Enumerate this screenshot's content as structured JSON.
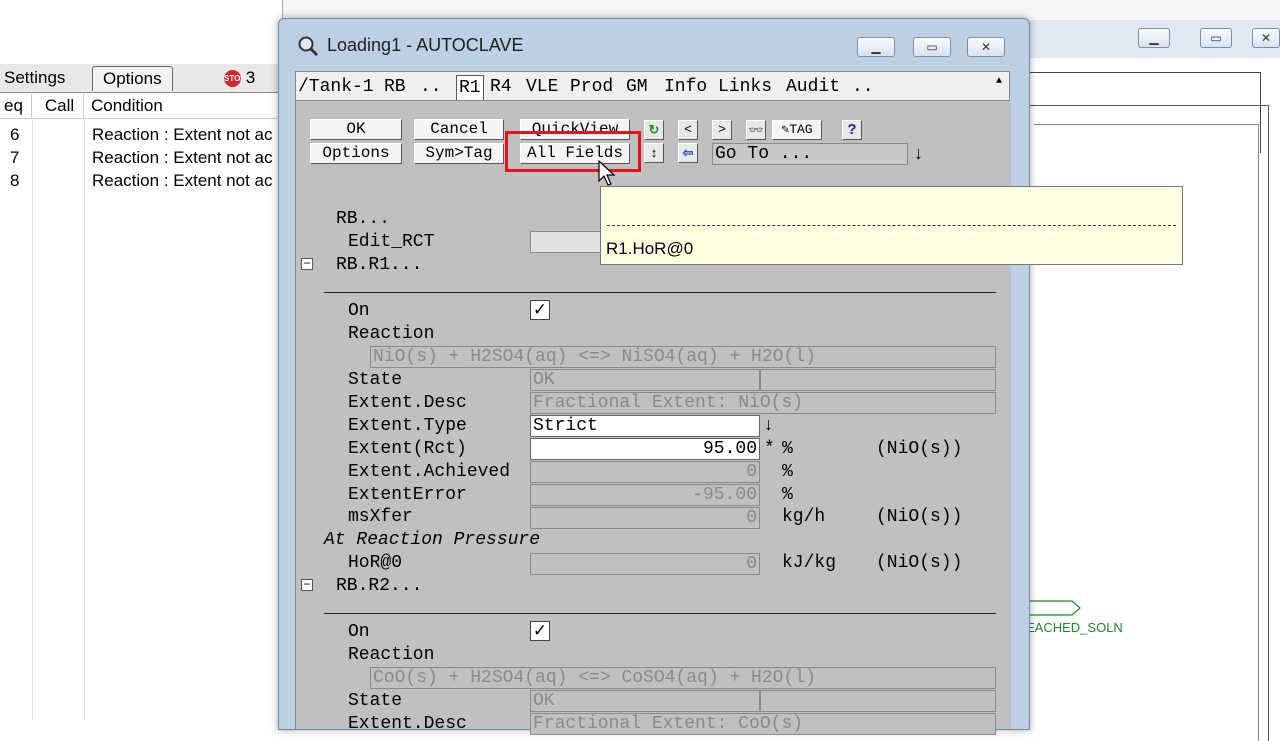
{
  "left_panel": {
    "tabs": [
      "Settings",
      "Options"
    ],
    "stop_badge": "STOP",
    "stop_count": "3",
    "columns": [
      "eq",
      "Call",
      "Condition"
    ],
    "rows": [
      {
        "seq": "6",
        "condition": "Reaction : Extent not ac"
      },
      {
        "seq": "7",
        "condition": "Reaction : Extent not ac"
      },
      {
        "seq": "8",
        "condition": "Reaction : Extent not ac"
      }
    ]
  },
  "right_panel": {
    "flow_label": "EACHED_SOLN",
    "flow_color": "#1a8a2a"
  },
  "dialog": {
    "title": "Loading1 - AUTOCLAVE",
    "tabs": [
      "/Tank-1",
      "RB",
      "..",
      "R1",
      "R4",
      "VLE",
      "Prod",
      "GM",
      "Info",
      "Links",
      "Audit",
      ".."
    ],
    "buttons": {
      "ok": "OK",
      "cancel": "Cancel",
      "quickview": "QuickView",
      "options": "Options",
      "symtag": "Sym>Tag",
      "allfields": "All Fields",
      "prev": "<",
      "next": ">",
      "tag": "TAG",
      "help": "?"
    },
    "goto": "Go To ...",
    "tooltip": "R1.HoR@0",
    "highlight_color": "#e3131b",
    "rb": {
      "label": "RB...",
      "edit_rct": "Edit_RCT"
    },
    "r1": {
      "header": "RB.R1...",
      "on": "On",
      "reaction_label": "Reaction",
      "reaction": "NiO(s) + H2SO4(aq) <=> NiSO4(aq) + H2O(l)",
      "state_label": "State",
      "state": "OK",
      "extent_desc_label": "Extent.Desc",
      "extent_desc": "Fractional Extent: NiO(s)",
      "extent_type_label": "Extent.Type",
      "extent_type": "Strict",
      "extent_rct_label": "Extent(Rct)",
      "extent_rct": "95.00",
      "extent_rct_unit": "%",
      "extent_rct_species": "(NiO(s))",
      "extent_achieved_label": "Extent.Achieved",
      "extent_achieved": "0",
      "extent_achieved_unit": "%",
      "extent_error_label": "ExtentError",
      "extent_error": "-95.00",
      "extent_error_unit": "%",
      "msxfer_label": "msXfer",
      "msxfer": "0",
      "msxfer_unit": "kg/h",
      "msxfer_species": "(NiO(s))",
      "pressure_heading": "At Reaction Pressure",
      "hor_label": "HoR@0",
      "hor": "0",
      "hor_unit": "kJ/kg",
      "hor_species": "(NiO(s))"
    },
    "r2": {
      "header": "RB.R2...",
      "on": "On",
      "reaction_label": "Reaction",
      "reaction": "CoO(s) + H2SO4(aq) <=> CoSO4(aq) + H2O(l)",
      "state_label": "State",
      "state": "OK",
      "extent_desc_label": "Extent.Desc",
      "extent_desc": "Fractional Extent: CoO(s)"
    }
  }
}
